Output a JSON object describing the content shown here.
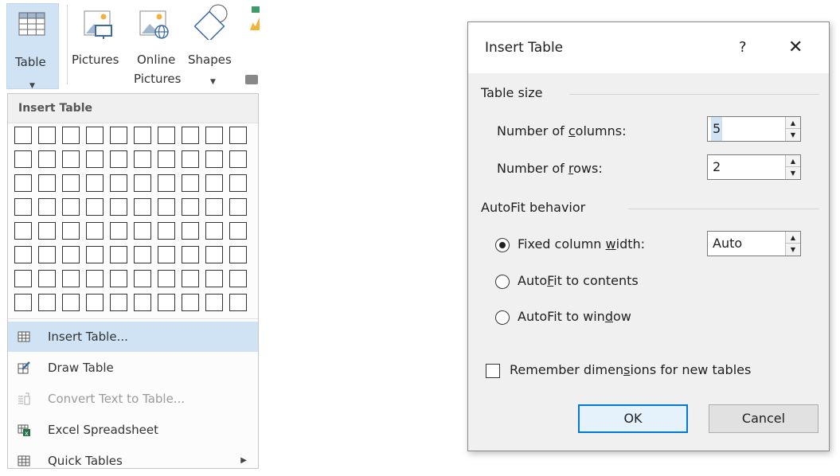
{
  "ribbon": {
    "table": {
      "label": "Table"
    },
    "pictures": {
      "label": "Pictures"
    },
    "online_pictures": {
      "label_1": "Online",
      "label_2": "Pictures"
    },
    "shapes": {
      "label": "Shapes"
    }
  },
  "menu": {
    "header": "Insert Table",
    "grid": {
      "columns": 10,
      "rows": 8
    },
    "items": [
      {
        "label": "Insert Table...",
        "icon": "table-grid-icon",
        "highlighted": true
      },
      {
        "label": "Draw Table",
        "icon": "pencil-table-icon"
      },
      {
        "label": "Convert Text to Table...",
        "icon": "convert-text-icon",
        "disabled": true
      },
      {
        "label": "Excel Spreadsheet",
        "icon": "excel-icon"
      },
      {
        "label": "Quick Tables",
        "icon": "table-grid-icon",
        "submenu": true
      }
    ]
  },
  "dialog": {
    "title": "Insert Table",
    "help": "?",
    "close": "✕",
    "table_size": {
      "group": "Table size",
      "columns_label": "Number of columns:",
      "columns_value": "5",
      "rows_label": "Number of rows:",
      "rows_value": "2"
    },
    "autofit": {
      "group": "AutoFit behavior",
      "fixed_label": "Fixed column width:",
      "fixed_value": "Auto",
      "contents_label": "AutoFit to contents",
      "window_label": "AutoFit to window",
      "selected": "fixed"
    },
    "remember_label": "Remember dimensions for new tables",
    "remember_checked": false,
    "ok": "OK",
    "cancel": "Cancel"
  },
  "colors": {
    "highlight": "#cfe3f5",
    "accent": "#0078d7",
    "excel_green": "#217346"
  }
}
